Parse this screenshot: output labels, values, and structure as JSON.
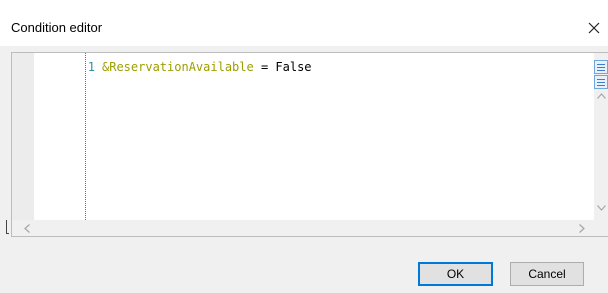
{
  "dialog": {
    "title": "Condition editor",
    "close_icon": "close-icon"
  },
  "editor": {
    "lines": [
      {
        "number": "1",
        "tokens": {
          "variable": "&ReservationAvailable",
          "operator": " = ",
          "value": "False"
        }
      }
    ],
    "colors": {
      "variable": "#9e9e00",
      "line_number": "#2b91af",
      "split_accent": "#3d7cc9"
    },
    "icons": {
      "split_top": "split-view-icon",
      "split_bottom": "split-view-icon",
      "scroll_up": "chevron-up-icon",
      "scroll_down": "chevron-down-icon",
      "scroll_left": "chevron-left-icon",
      "scroll_right": "chevron-right-icon"
    }
  },
  "buttons": {
    "ok_label": "OK",
    "cancel_label": "Cancel"
  }
}
